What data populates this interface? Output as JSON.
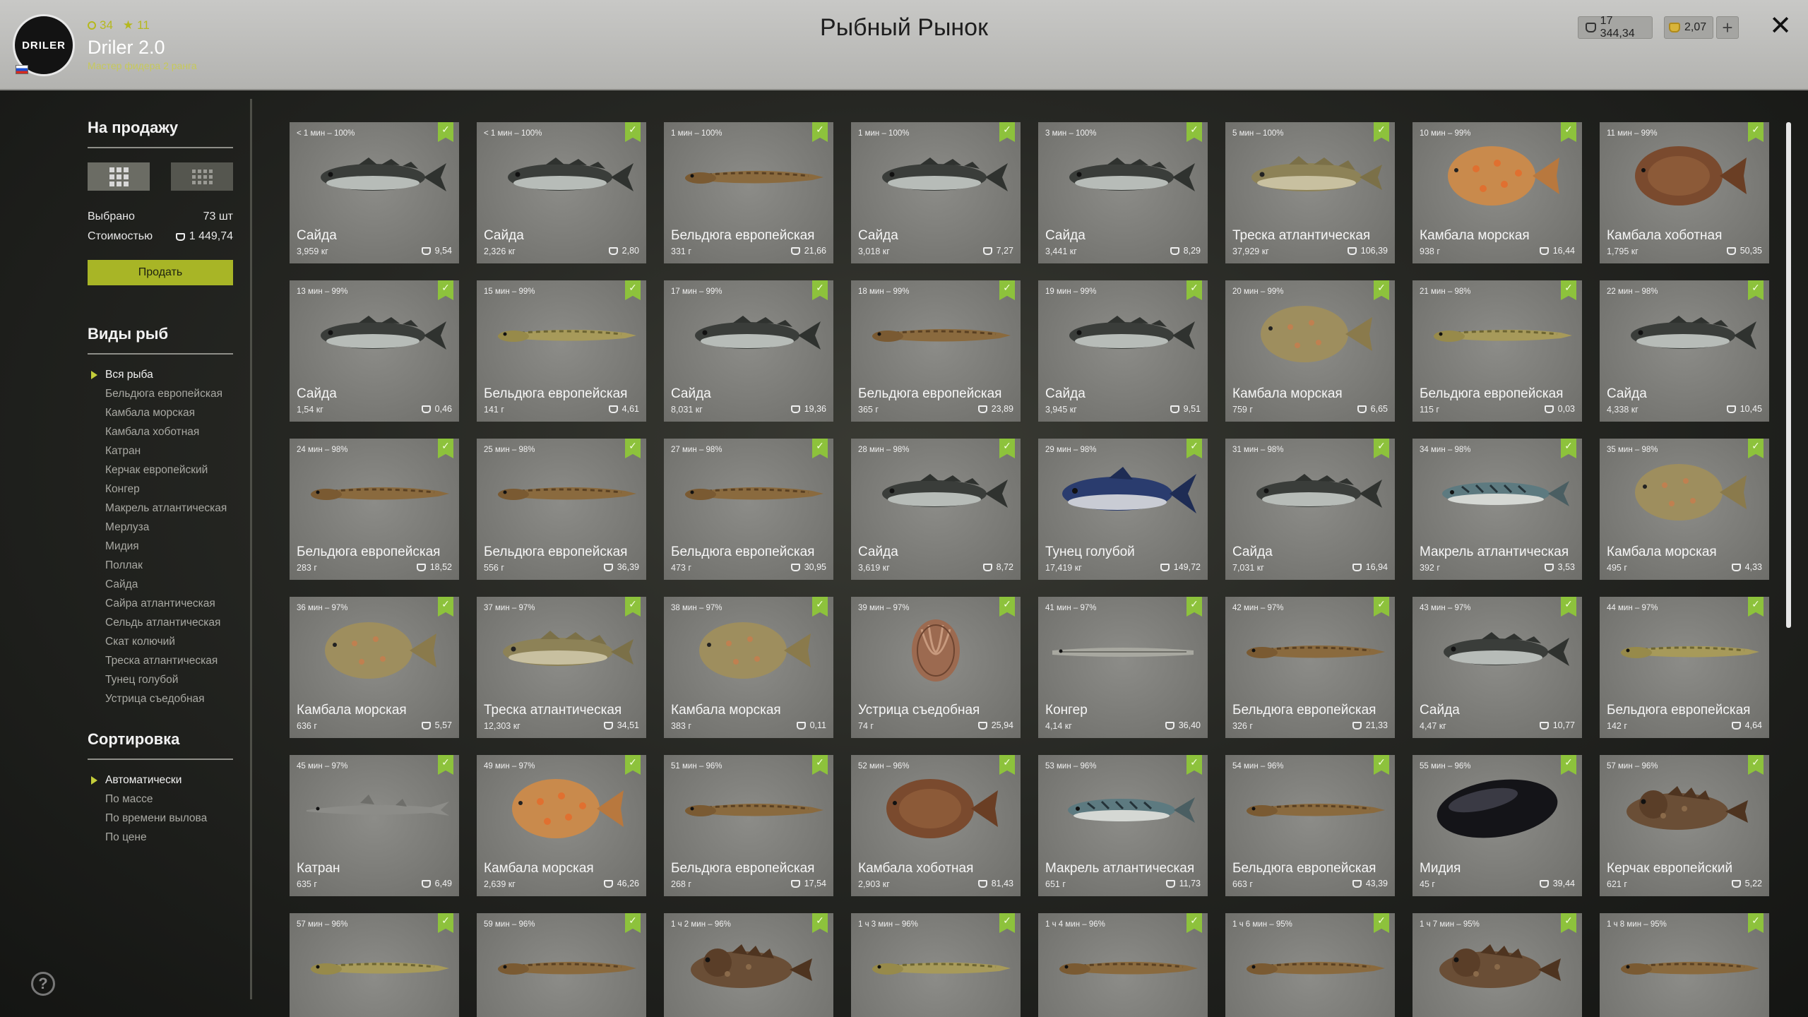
{
  "header": {
    "logo_text": "DRILER",
    "level": "34",
    "stars": "11",
    "player_name": "Driler 2.0",
    "rank": "Мастер фидера 2 ранга",
    "title": "Рыбный Рынок",
    "silver": "17 344,34",
    "gold": "2,07",
    "plus": "+",
    "close": "✕"
  },
  "sidebar": {
    "sale_title": "На продажу",
    "selected_label": "Выбрано",
    "selected_value": "73 шт",
    "cost_label": "Стоимостью",
    "cost_value": "1 449,74",
    "sell_button": "Продать",
    "species_title": "Виды рыб",
    "species": [
      "Вся рыба",
      "Бельдюга европейская",
      "Камбала морская",
      "Камбала хоботная",
      "Катран",
      "Керчак европейский",
      "Конгер",
      "Макрель атлантическая",
      "Мерлуза",
      "Мидия",
      "Поллак",
      "Сайда",
      "Сайра атлантическая",
      "Сельдь атлантическая",
      "Скат колючий",
      "Треска атлантическая",
      "Тунец голубой",
      "Устрица съедобная"
    ],
    "sort_title": "Сортировка",
    "sort": [
      "Автоматически",
      "По массе",
      "По времени вылова",
      "По цене"
    ]
  },
  "theme": {
    "accent": "#a8b526",
    "check": "#8dc23c",
    "header_bg": "#bdbdba"
  },
  "cards": [
    {
      "time": "< 1 мин – 100%",
      "name": "Сайда",
      "weight": "3,959 кг",
      "price": "9,54",
      "kind": "pollock"
    },
    {
      "time": "< 1 мин – 100%",
      "name": "Сайда",
      "weight": "2,326 кг",
      "price": "2,80",
      "kind": "pollock"
    },
    {
      "time": "1 мин – 100%",
      "name": "Бельдюга европейская",
      "weight": "331 г",
      "price": "21,66",
      "kind": "eelpout"
    },
    {
      "time": "1 мин – 100%",
      "name": "Сайда",
      "weight": "3,018 кг",
      "price": "7,27",
      "kind": "pollock"
    },
    {
      "time": "3 мин – 100%",
      "name": "Сайда",
      "weight": "3,441 кг",
      "price": "8,29",
      "kind": "pollock"
    },
    {
      "time": "5 мин – 100%",
      "name": "Треска атлантическая",
      "weight": "37,929 кг",
      "price": "106,39",
      "kind": "cod"
    },
    {
      "time": "10 мин – 99%",
      "name": "Камбала морская",
      "weight": "938 г",
      "price": "16,44",
      "kind": "plaice"
    },
    {
      "time": "11 мин – 99%",
      "name": "Камбала хоботная",
      "weight": "1,795 кг",
      "price": "50,35",
      "kind": "dab"
    },
    {
      "time": "13 мин – 99%",
      "name": "Сайда",
      "weight": "1,54 кг",
      "price": "0,46",
      "kind": "pollock"
    },
    {
      "time": "15 мин – 99%",
      "name": "Бельдюга европейская",
      "weight": "141 г",
      "price": "4,61",
      "kind": "eelpout2"
    },
    {
      "time": "17 мин – 99%",
      "name": "Сайда",
      "weight": "8,031 кг",
      "price": "19,36",
      "kind": "pollock"
    },
    {
      "time": "18 мин – 99%",
      "name": "Бельдюга европейская",
      "weight": "365 г",
      "price": "23,89",
      "kind": "eelpout"
    },
    {
      "time": "19 мин – 99%",
      "name": "Сайда",
      "weight": "3,945 кг",
      "price": "9,51",
      "kind": "pollock"
    },
    {
      "time": "20 мин – 99%",
      "name": "Камбала морская",
      "weight": "759 г",
      "price": "6,65",
      "kind": "plaice2"
    },
    {
      "time": "21 мин – 98%",
      "name": "Бельдюга европейская",
      "weight": "115 г",
      "price": "0,03",
      "kind": "eelpout2"
    },
    {
      "time": "22 мин – 98%",
      "name": "Сайда",
      "weight": "4,338 кг",
      "price": "10,45",
      "kind": "pollock"
    },
    {
      "time": "24 мин – 98%",
      "name": "Бельдюга европейская",
      "weight": "283 г",
      "price": "18,52",
      "kind": "eelpout"
    },
    {
      "time": "25 мин – 98%",
      "name": "Бельдюга европейская",
      "weight": "556 г",
      "price": "36,39",
      "kind": "eelpout"
    },
    {
      "time": "27 мин – 98%",
      "name": "Бельдюга европейская",
      "weight": "473 г",
      "price": "30,95",
      "kind": "eelpout"
    },
    {
      "time": "28 мин – 98%",
      "name": "Сайда",
      "weight": "3,619 кг",
      "price": "8,72",
      "kind": "pollock"
    },
    {
      "time": "29 мин – 98%",
      "name": "Тунец голубой",
      "weight": "17,419 кг",
      "price": "149,72",
      "kind": "tuna"
    },
    {
      "time": "31 мин – 98%",
      "name": "Сайда",
      "weight": "7,031 кг",
      "price": "16,94",
      "kind": "pollock"
    },
    {
      "time": "34 мин – 98%",
      "name": "Макрель атлантическая",
      "weight": "392 г",
      "price": "3,53",
      "kind": "mackerel"
    },
    {
      "time": "35 мин – 98%",
      "name": "Камбала морская",
      "weight": "495 г",
      "price": "4,33",
      "kind": "plaice2"
    },
    {
      "time": "36 мин – 97%",
      "name": "Камбала морская",
      "weight": "636 г",
      "price": "5,57",
      "kind": "plaice2"
    },
    {
      "time": "37 мин – 97%",
      "name": "Треска атлантическая",
      "weight": "12,303 кг",
      "price": "34,51",
      "kind": "cod"
    },
    {
      "time": "38 мин – 97%",
      "name": "Камбала морская",
      "weight": "383 г",
      "price": "0,11",
      "kind": "plaice2"
    },
    {
      "time": "39 мин – 97%",
      "name": "Устрица съедобная",
      "weight": "74 г",
      "price": "25,94",
      "kind": "oyster"
    },
    {
      "time": "41 мин – 97%",
      "name": "Конгер",
      "weight": "4,14 кг",
      "price": "36,40",
      "kind": "conger"
    },
    {
      "time": "42 мин – 97%",
      "name": "Бельдюга европейская",
      "weight": "326 г",
      "price": "21,33",
      "kind": "eelpout"
    },
    {
      "time": "43 мин – 97%",
      "name": "Сайда",
      "weight": "4,47 кг",
      "price": "10,77",
      "kind": "pollock"
    },
    {
      "time": "44 мин – 97%",
      "name": "Бельдюга европейская",
      "weight": "142 г",
      "price": "4,64",
      "kind": "eelpout2"
    },
    {
      "time": "45 мин – 97%",
      "name": "Катран",
      "weight": "635 г",
      "price": "6,49",
      "kind": "shark"
    },
    {
      "time": "49 мин – 97%",
      "name": "Камбала морская",
      "weight": "2,639 кг",
      "price": "46,26",
      "kind": "plaice"
    },
    {
      "time": "51 мин – 96%",
      "name": "Бельдюга европейская",
      "weight": "268 г",
      "price": "17,54",
      "kind": "eelpout"
    },
    {
      "time": "52 мин – 96%",
      "name": "Камбала хоботная",
      "weight": "2,903 кг",
      "price": "81,43",
      "kind": "dab"
    },
    {
      "time": "53 мин – 96%",
      "name": "Макрель атлантическая",
      "weight": "651 г",
      "price": "11,73",
      "kind": "mackerel"
    },
    {
      "time": "54 мин – 96%",
      "name": "Бельдюга европейская",
      "weight": "663 г",
      "price": "43,39",
      "kind": "eelpout"
    },
    {
      "time": "55 мин – 96%",
      "name": "Мидия",
      "weight": "45 г",
      "price": "39,44",
      "kind": "mussel"
    },
    {
      "time": "57 мин – 96%",
      "name": "Керчак европейский",
      "weight": "621 г",
      "price": "5,22",
      "kind": "sculpin"
    },
    {
      "time": "57 мин – 96%",
      "name": "",
      "weight": "",
      "price": "",
      "kind": "eelpout2"
    },
    {
      "time": "59 мин – 96%",
      "name": "",
      "weight": "",
      "price": "",
      "kind": "eelpout"
    },
    {
      "time": "1 ч 2 мин – 96%",
      "name": "",
      "weight": "",
      "price": "",
      "kind": "sculpin"
    },
    {
      "time": "1 ч 3 мин – 96%",
      "name": "",
      "weight": "",
      "price": "",
      "kind": "eelpout2"
    },
    {
      "time": "1 ч 4 мин – 96%",
      "name": "",
      "weight": "",
      "price": "",
      "kind": "eelpout"
    },
    {
      "time": "1 ч 6 мин – 95%",
      "name": "",
      "weight": "",
      "price": "",
      "kind": "eelpout"
    },
    {
      "time": "1 ч 7 мин – 95%",
      "name": "",
      "weight": "",
      "price": "",
      "kind": "sculpin"
    },
    {
      "time": "1 ч 8 мин – 95%",
      "name": "",
      "weight": "",
      "price": "",
      "kind": "eelpout"
    }
  ]
}
